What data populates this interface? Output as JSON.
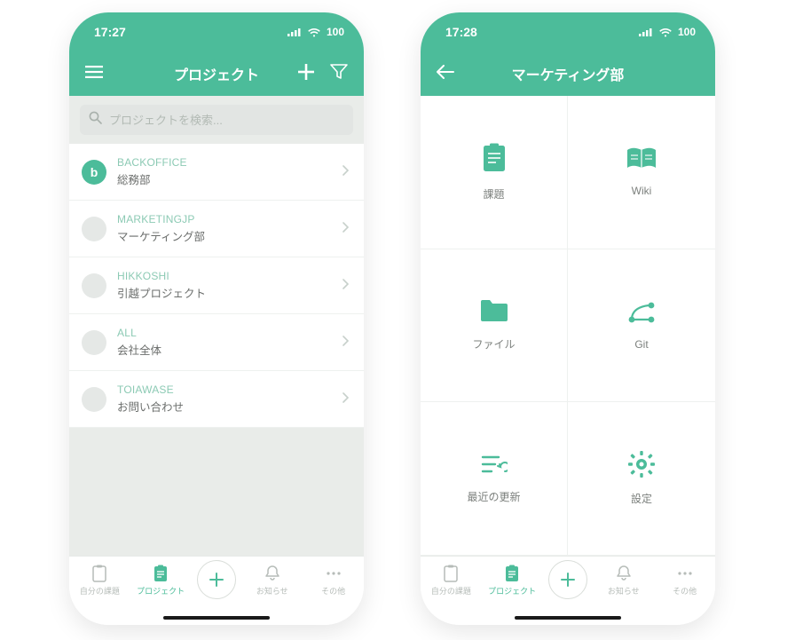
{
  "colors": {
    "accent": "#4cbc9a"
  },
  "left": {
    "status": {
      "time": "17:27",
      "battery": "100"
    },
    "title": "プロジェクト",
    "search": {
      "placeholder": "プロジェクトを検索..."
    },
    "projects": [
      {
        "code": "BACKOFFICE",
        "name": "総務部",
        "avatar": "b",
        "filled": true
      },
      {
        "code": "MARKETINGJP",
        "name": "マーケティング部",
        "avatar": "",
        "filled": false
      },
      {
        "code": "HIKKOSHI",
        "name": "引越プロジェクト",
        "avatar": "",
        "filled": false
      },
      {
        "code": "ALL",
        "name": "会社全体",
        "avatar": "",
        "filled": false
      },
      {
        "code": "TOIAWASE",
        "name": "お問い合わせ",
        "avatar": "",
        "filled": false
      }
    ]
  },
  "right": {
    "status": {
      "time": "17:28",
      "battery": "100"
    },
    "title": "マーケティング部",
    "grid": [
      {
        "key": "issues",
        "label": "課題"
      },
      {
        "key": "wiki",
        "label": "Wiki"
      },
      {
        "key": "files",
        "label": "ファイル"
      },
      {
        "key": "git",
        "label": "Git"
      },
      {
        "key": "recent",
        "label": "最近の更新"
      },
      {
        "key": "settings",
        "label": "設定"
      }
    ]
  },
  "tabs": {
    "items": [
      {
        "key": "myissues",
        "label": "自分の課題"
      },
      {
        "key": "projects",
        "label": "プロジェクト"
      },
      {
        "key": "notice",
        "label": "お知らせ"
      },
      {
        "key": "other",
        "label": "その他"
      }
    ]
  }
}
